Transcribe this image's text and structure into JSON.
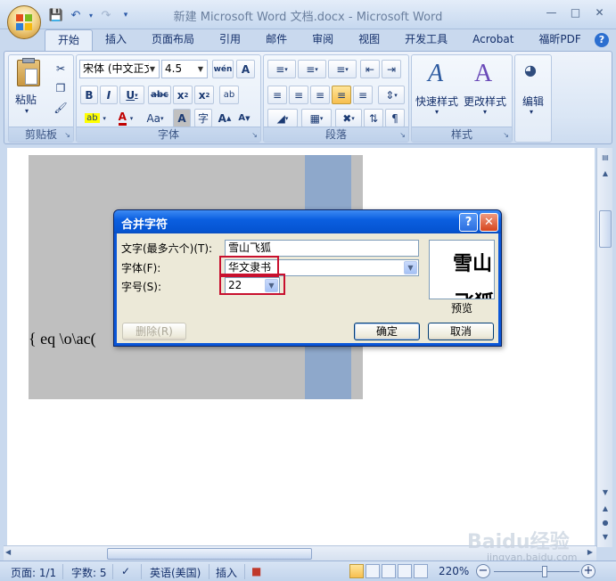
{
  "window": {
    "title": "新建 Microsoft Word 文档.docx - Microsoft Word"
  },
  "ribbon": {
    "tabs": [
      "开始",
      "插入",
      "页面布局",
      "引用",
      "邮件",
      "审阅",
      "视图",
      "开发工具",
      "Acrobat",
      "福昕PDF"
    ],
    "groups": {
      "clipboard": {
        "label": "剪贴板",
        "paste": "粘贴"
      },
      "font": {
        "label": "字体",
        "font_name": "宋体 (中文正文)",
        "font_size": "4.5"
      },
      "paragraph": {
        "label": "段落"
      },
      "styles": {
        "label": "样式",
        "quick_styles": "快速样式",
        "change_styles": "更改样式"
      },
      "editing": {
        "label": "编辑"
      }
    }
  },
  "document": {
    "field_code": "{ eq \\o\\ac("
  },
  "dialog": {
    "title": "合并字符",
    "text_label": "文字(最多六个)(T):",
    "text_value": "雪山飞狐",
    "font_label": "字体(F):",
    "font_value": "华文隶书",
    "size_label": "字号(S):",
    "size_value": "22",
    "preview_label": "预览",
    "preview_text_top": "雪山",
    "preview_text_bottom": "飞狐",
    "delete_button": "删除(R)",
    "ok_button": "确定",
    "cancel_button": "取消"
  },
  "statusbar": {
    "page": "页面: 1/1",
    "words": "字数: 5",
    "language": "英语(美国)",
    "mode": "插入",
    "zoom": "220%"
  },
  "watermark": {
    "brand": "Baidu经验",
    "url": "jingyan.baidu.com"
  }
}
